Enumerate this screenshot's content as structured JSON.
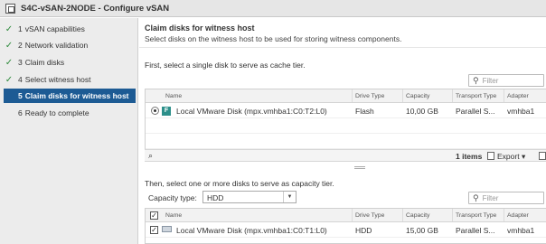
{
  "window": {
    "title": "S4C-vSAN-2NODE - Configure vSAN"
  },
  "steps": [
    {
      "num": "1",
      "label": "vSAN capabilities",
      "done": true
    },
    {
      "num": "2",
      "label": "Network validation",
      "done": true
    },
    {
      "num": "3",
      "label": "Claim disks",
      "done": true
    },
    {
      "num": "4",
      "label": "Select witness host",
      "done": true
    },
    {
      "num": "5",
      "label": "Claim disks for witness host",
      "active": true
    },
    {
      "num": "6",
      "label": "Ready to complete"
    }
  ],
  "header": {
    "title": "Claim disks for witness host",
    "subtitle": "Select disks on the witness host to be used for storing witness components."
  },
  "cache_section": {
    "instruction": "First, select a single disk to serve as cache tier.",
    "filter_placeholder": "Filter",
    "columns": [
      "Name",
      "Drive Type",
      "Capacity",
      "Transport Type",
      "Adapter"
    ],
    "rows": [
      {
        "name": "Local VMware Disk (mpx.vmhba1:C0:T2:L0)",
        "drive_type": "Flash",
        "capacity": "10,00 GB",
        "transport": "Parallel S...",
        "adapter": "vmhba1",
        "selected": true,
        "icon": "flash-disk-icon"
      }
    ],
    "footer": {
      "items": "1 items",
      "export": "Export"
    }
  },
  "capacity_section": {
    "instruction": "Then, select one or more disks to serve as capacity tier.",
    "capacity_type_label": "Capacity type:",
    "capacity_type_value": "HDD",
    "filter_placeholder": "Filter",
    "columns": [
      "Name",
      "Drive Type",
      "Capacity",
      "Transport Type",
      "Adapter"
    ],
    "rows": [
      {
        "name": "Local VMware Disk (mpx.vmhba1:C0:T1:L0)",
        "drive_type": "HDD",
        "capacity": "15,00 GB",
        "transport": "Parallel S...",
        "adapter": "vmhba1",
        "checked": true,
        "icon": "hdd-disk-icon"
      }
    ]
  },
  "colors": {
    "active_step": "#1d5b94",
    "check": "#2e8b3c",
    "flash_icon": "#2c8f8a"
  }
}
